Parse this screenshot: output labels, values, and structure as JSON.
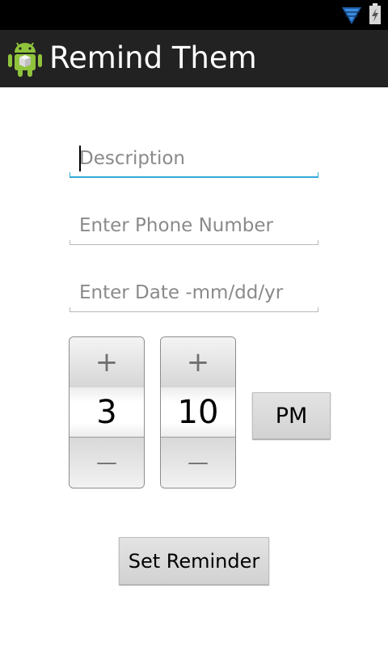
{
  "status_bar": {
    "wifi_icon": "wifi-icon",
    "battery_icon": "battery-charging-icon"
  },
  "action_bar": {
    "title": "Remind Them",
    "icon": "android-icon"
  },
  "form": {
    "description": {
      "placeholder": "Description",
      "value": ""
    },
    "phone": {
      "placeholder": "Enter Phone Number",
      "value": ""
    },
    "date": {
      "placeholder": "Enter Date -mm/dd/yr",
      "value": ""
    }
  },
  "time_picker": {
    "hour": {
      "value": "3",
      "increment": "+",
      "decrement": "—"
    },
    "minute": {
      "value": "10",
      "increment": "+",
      "decrement": "—"
    },
    "ampm": "PM"
  },
  "set_reminder_label": "Set Reminder",
  "colors": {
    "action_bar": "#222222",
    "focus_accent": "#33a8d8",
    "background": "#ffffff"
  }
}
